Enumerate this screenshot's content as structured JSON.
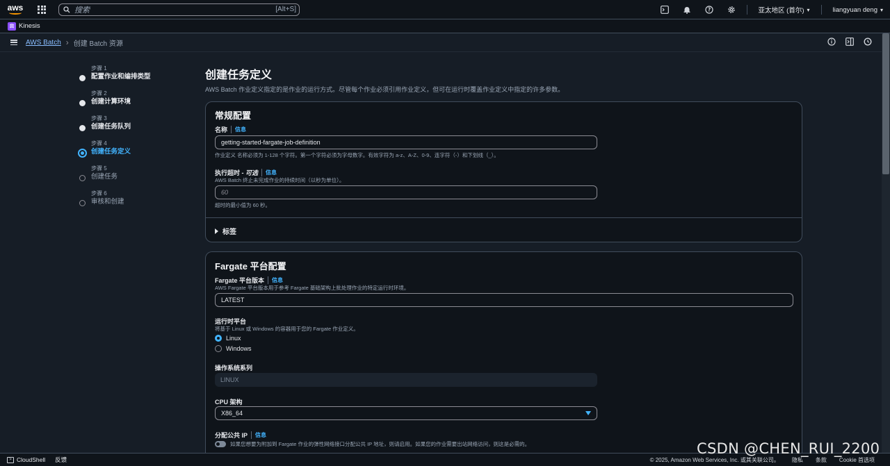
{
  "topbar": {
    "logo_text": "aws",
    "search_placeholder": "搜索",
    "search_shortcut": "[Alt+S]",
    "region": "亚太地区 (首尔)",
    "user": "liangyuan deng"
  },
  "service": {
    "name": "Kinesis"
  },
  "breadcrumb": {
    "root": "AWS Batch",
    "current": "创建 Batch 资源"
  },
  "steps": [
    {
      "num": "步骤 1",
      "name": "配置作业和编排类型",
      "state": "done"
    },
    {
      "num": "步骤 2",
      "name": "创建计算环境",
      "state": "done"
    },
    {
      "num": "步骤 3",
      "name": "创建任务队列",
      "state": "done"
    },
    {
      "num": "步骤 4",
      "name": "创建任务定义",
      "state": "active"
    },
    {
      "num": "步骤 5",
      "name": "创建任务",
      "state": "future"
    },
    {
      "num": "步骤 6",
      "name": "审核和创建",
      "state": "future"
    }
  ],
  "page": {
    "title": "创建任务定义",
    "description": "AWS Batch 作业定义指定的是作业的运行方式。尽管每个作业必须引用作业定义，但可在运行时覆盖作业定义中指定的许多参数。"
  },
  "general": {
    "title": "常规配置",
    "name_label": "名称",
    "info": "信息",
    "name_value": "getting-started-fargate-job-definition",
    "name_hint": "作业定义 名称必须为 1-128 个字符。第一个字符必须为字母数字。有效字符为 a-z、A-Z、0-9、连字符（-）和下划线（_）。",
    "timeout_label": "执行超时 - ",
    "timeout_optional": "可选",
    "timeout_hint": "AWS Batch 终止未完成作业的持续时间（以秒为单位）。",
    "timeout_placeholder": "60",
    "timeout_min": "超时的最小值为 60 秒。",
    "tags_label": "标签"
  },
  "fargate": {
    "title": "Fargate 平台配置",
    "version_label": "Fargate 平台版本",
    "info": "信息",
    "version_hint": "AWS Fargate 平台版本用于参考 Fargate 基础架构上批处理作业的特定运行时环境。",
    "version_value": "LATEST",
    "runtime_label": "运行时平台",
    "runtime_hint": "将基于 Linux 或 Windows 的容器用于您的 Fargate 作业定义。",
    "runtime_options": [
      "Linux",
      "Windows"
    ],
    "os_label": "操作系统系列",
    "os_value": "LINUX",
    "cpu_label": "CPU 架构",
    "cpu_value": "X86_64",
    "public_ip_label": "分配公共 IP",
    "public_ip_hint": "如果您想要为附加到 Fargate 作业的弹性网络接口分配公共 IP 地址，则请启用。如果您的作业需要出站网络访问，则这是必需的。"
  },
  "footer": {
    "cloudshell": "CloudShell",
    "feedback": "反馈",
    "copyright": "© 2025, Amazon Web Services, Inc. 或其关联公司。",
    "privacy": "隐私",
    "terms": "条款",
    "cookie": "Cookie 首选项"
  },
  "watermark": "CSDN @CHEN_RUI_2200",
  "colors": {
    "accent": "#42b4ff",
    "background": "#161d26",
    "panel": "#0f141a",
    "aws_orange": "#ff9900",
    "kinesis": "#8c4fff"
  }
}
